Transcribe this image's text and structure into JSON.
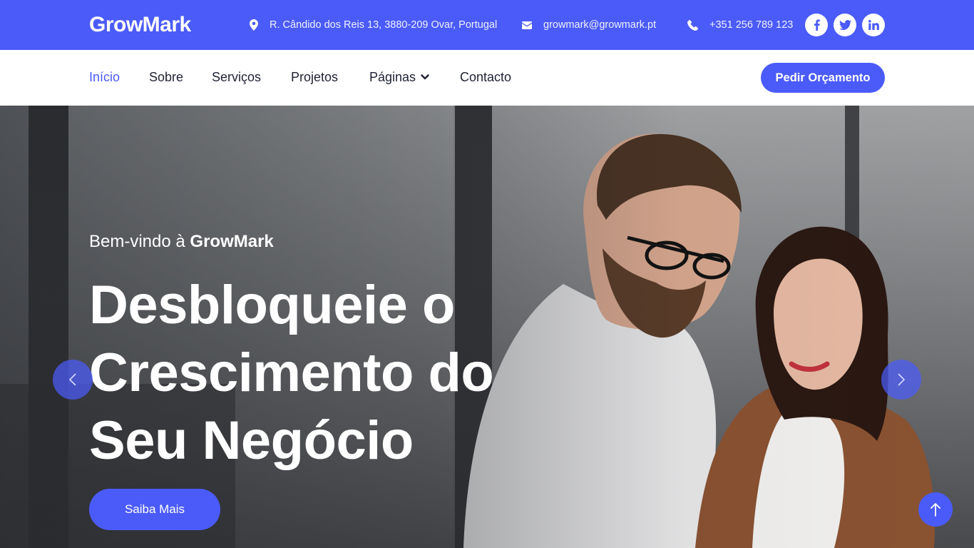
{
  "brand": {
    "name": "GrowMark",
    "accent": "#4b5bf9"
  },
  "topbar": {
    "address": {
      "icon": "map-pin-icon",
      "text": "R. Cândido dos Reis 13, 3880-209 Ovar, Portugal"
    },
    "email": {
      "icon": "envelope-icon",
      "text": "growmark@growmark.pt"
    },
    "phone": {
      "icon": "phone-icon",
      "text": "+351 256 789 123"
    },
    "socials": [
      {
        "icon": "facebook-icon"
      },
      {
        "icon": "twitter-icon"
      },
      {
        "icon": "linkedin-icon"
      }
    ]
  },
  "nav": {
    "items": [
      {
        "label": "Início",
        "active": true
      },
      {
        "label": "Sobre"
      },
      {
        "label": "Serviços"
      },
      {
        "label": "Projetos"
      },
      {
        "label": "Páginas",
        "dropdown": true
      },
      {
        "label": "Contacto"
      }
    ],
    "quote_button": "Pedir Orçamento"
  },
  "hero": {
    "welcome_prefix": "Bem-vindo à",
    "welcome_brand": "GrowMark",
    "headline": "Desbloqueie o Crescimento do Seu Negócio",
    "cta": "Saiba Mais",
    "prev_icon": "chevron-left-icon",
    "next_icon": "chevron-right-icon",
    "scroll_top_icon": "arrow-up-icon"
  }
}
